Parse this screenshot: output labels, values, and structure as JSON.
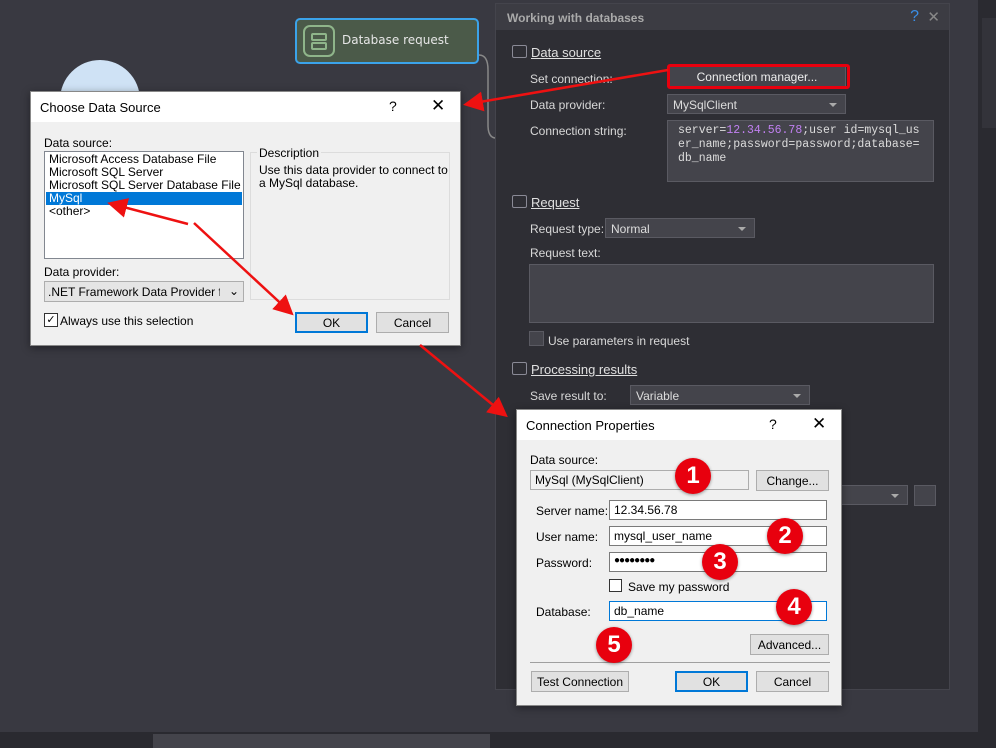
{
  "canvas": {
    "node_label": "Database request"
  },
  "panel": {
    "title": "Working with databases",
    "help": "?",
    "close": "✕",
    "data_source_heading": "Data source",
    "set_connection_label": "Set connection:",
    "connection_manager_button": "Connection manager...",
    "data_provider_label": "Data provider:",
    "data_provider_value": "MySqlClient",
    "connection_string_label": "Connection string:",
    "connection_string": {
      "p1": "server=",
      "ip": "12.34.56.78",
      "p2": ";user id=mysql_user_name;password=password;database=db_name"
    },
    "request_heading": "Request",
    "request_type_label": "Request type:",
    "request_type_value": "Normal",
    "request_text_label": "Request text:",
    "request_text": "",
    "use_parameters_label": "Use parameters in request",
    "processing_heading": "Processing results",
    "save_result_label": "Save result to:",
    "save_result_value": "Variable"
  },
  "choose_dialog": {
    "title": "Choose Data Source",
    "help": "?",
    "close": "✕",
    "data_source_label": "Data source:",
    "sources": [
      "Microsoft Access Database File",
      "Microsoft SQL Server",
      "Microsoft SQL Server Database File",
      "MySql",
      "<other>"
    ],
    "selected": "MySql",
    "description_heading": "Description",
    "description": "Use this data provider to connect to a MySql database.",
    "data_provider_label": "Data provider:",
    "data_provider_value": ".NET Framework Data Provider for My",
    "always_use_label": "Always use this selection",
    "ok": "OK",
    "cancel": "Cancel"
  },
  "conn_dialog": {
    "title": "Connection Properties",
    "help": "?",
    "close": "✕",
    "data_source_label": "Data source:",
    "data_source_value": "MySql (MySqlClient)",
    "change": "Change...",
    "server_label": "Server name:",
    "server_value": "12.34.56.78",
    "user_label": "User name:",
    "user_value": "mysql_user_name",
    "password_label": "Password:",
    "password_value": "●●●●●●●●",
    "save_password_label": "Save my password",
    "database_label": "Database:",
    "database_value": "db_name",
    "advanced": "Advanced...",
    "test": "Test Connection",
    "ok": "OK",
    "cancel": "Cancel"
  },
  "markers": [
    "1",
    "2",
    "3",
    "4",
    "5"
  ],
  "colors": {
    "accent": "#0078d7",
    "annotation": "#e8000e"
  }
}
